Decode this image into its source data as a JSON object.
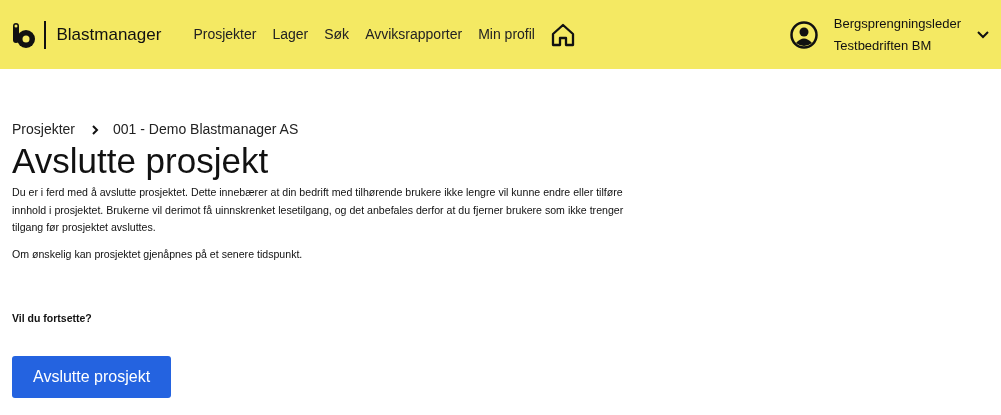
{
  "header": {
    "brand": "Blastmanager",
    "nav": [
      {
        "label": "Prosjekter"
      },
      {
        "label": "Lager"
      },
      {
        "label": "Søk"
      },
      {
        "label": "Avviksrapporter"
      },
      {
        "label": "Min profil"
      }
    ],
    "user": {
      "role": "Bergsprengningsleder",
      "company": "Testbedriften BM"
    }
  },
  "breadcrumb": [
    {
      "label": "Prosjekter"
    },
    {
      "label": "001 - Demo Blastmanager AS"
    }
  ],
  "title": "Avslutte prosjekt",
  "paragraphs": [
    "Du er i ferd med å avslutte prosjektet. Dette innebærer at din bedrift med tilhørende brukere ikke lengre vil kunne endre eller tilføre innhold i prosjektet. Brukerne vil derimot få uinnskrenket lesetilgang, og det anbefales derfor at du fjerner brukere som ikke trenger tilgang før prosjektet avsluttes.",
    "Om ønskelig kan prosjektet gjenåpnes på et senere tidspunkt."
  ],
  "question": "Vil du fortsette?",
  "button": "Avslutte prosjekt"
}
